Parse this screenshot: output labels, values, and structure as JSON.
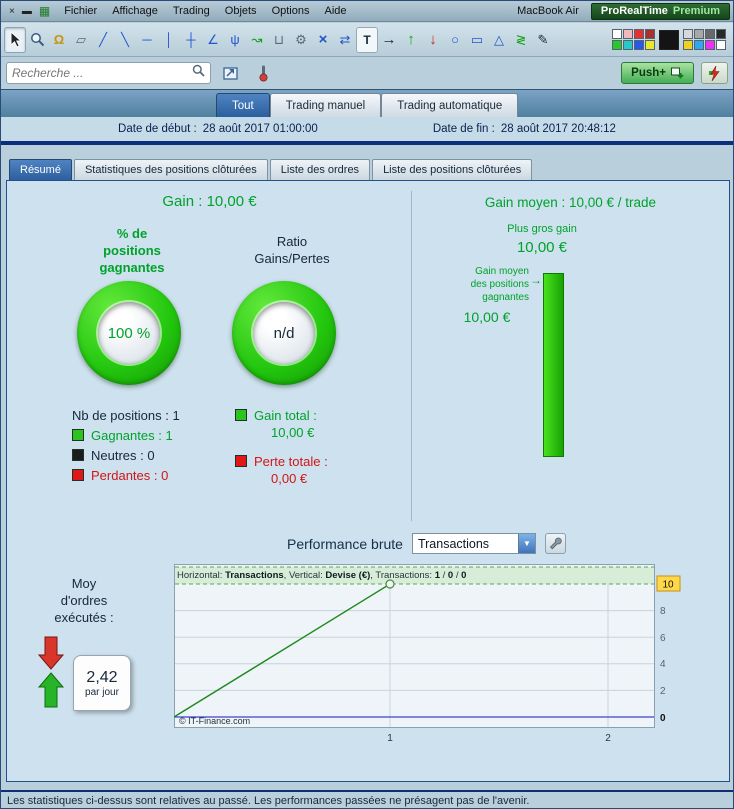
{
  "window_controls": {
    "close_glyph": "×",
    "minimize_glyph": "▬",
    "app_glyph": "▦"
  },
  "titlebar": {
    "menus": [
      "Fichier",
      "Affichage",
      "Trading",
      "Objets",
      "Options",
      "Aide"
    ],
    "machine": "MacBook Air",
    "brand": "ProRealTime",
    "brand_edition": "Premium"
  },
  "toolbar": {
    "icons": [
      {
        "name": "pointer-tool-icon",
        "glyph": ""
      },
      {
        "name": "zoom-icon",
        "glyph": ""
      },
      {
        "name": "alarm-bell-icon",
        "glyph": "Ω"
      },
      {
        "name": "ruler-icon",
        "glyph": "▱"
      },
      {
        "name": "trendline-icon",
        "glyph": "╱"
      },
      {
        "name": "segment-icon",
        "glyph": "╲"
      },
      {
        "name": "horizontal-line-icon",
        "glyph": "─"
      },
      {
        "name": "vertical-line-icon",
        "glyph": "│"
      },
      {
        "name": "cross-line-icon",
        "glyph": "┼"
      },
      {
        "name": "fan-lines-icon",
        "glyph": "∠"
      },
      {
        "name": "pitchfork-icon",
        "glyph": "ψ"
      },
      {
        "name": "price-pattern-icon",
        "glyph": "↝"
      },
      {
        "name": "trash-icon",
        "glyph": "⊔"
      },
      {
        "name": "tools-icon",
        "glyph": "⚙"
      },
      {
        "name": "crossed-arrows-icon",
        "glyph": "×"
      },
      {
        "name": "swap-arrows-icon",
        "glyph": "⇄"
      },
      {
        "name": "text-tool-icon",
        "glyph": "T"
      },
      {
        "name": "arrow-annotation-icon",
        "glyph": "→"
      },
      {
        "name": "buy-arrow-icon",
        "glyph": "↑"
      },
      {
        "name": "sell-arrow-icon",
        "glyph": "↓"
      },
      {
        "name": "ellipse-tool-icon",
        "glyph": "○"
      },
      {
        "name": "rectangle-tool-icon",
        "glyph": "▭"
      },
      {
        "name": "triangle-tool-icon",
        "glyph": "△"
      },
      {
        "name": "zigzag-icon",
        "glyph": "≷"
      },
      {
        "name": "pencil-plus-icon",
        "glyph": "✎"
      }
    ],
    "palette_left": [
      [
        "#ffffff",
        "#f2b8c0",
        "#e83030",
        "#a83030"
      ],
      [
        "#28c828",
        "#28c8c8",
        "#2858e8",
        "#e8e828"
      ]
    ],
    "palette_main": "#141414",
    "palette_right": [
      [
        "#d8d8d8",
        "#a8a8a8",
        "#686868",
        "#282828"
      ],
      [
        "#f0d020",
        "#30a8f0",
        "#f030f0",
        "#ffffff"
      ]
    ]
  },
  "search": {
    "placeholder": "Recherche ...",
    "push_label": "Push+"
  },
  "view_tabs": [
    {
      "label": "Tout"
    },
    {
      "label": "Trading manuel"
    },
    {
      "label": "Trading automatique"
    }
  ],
  "dates": {
    "start_label": "Date de début :",
    "start_value": "28 août 2017 01:00:00",
    "end_label": "Date de fin :",
    "end_value": "28 août 2017 20:48:12"
  },
  "panel_tabs": [
    {
      "label": "Résumé"
    },
    {
      "label": "Statistiques des positions clôturées"
    },
    {
      "label": "Liste des ordres"
    },
    {
      "label": "Liste des positions clôturées"
    }
  ],
  "summary": {
    "gain_label": "Gain :",
    "gain_value": "10,00 €",
    "winning_pct_title": "% de\npositions\ngagnantes",
    "winning_pct_value": "100 %",
    "ratio_title": "Ratio\nGains/Pertes",
    "ratio_value": "n/d",
    "nb_positions": "Nb de positions : 1",
    "winners": "Gagnantes : 1",
    "neutrals": "Neutres : 0",
    "losers": "Perdantes : 0",
    "gain_total_label": "Gain total :",
    "gain_total_value": "10,00 €",
    "loss_total_label": "Perte totale :",
    "loss_total_value": "0,00 €"
  },
  "right_stats": {
    "avg_gain_label": "Gain moyen :",
    "avg_gain_value": "10,00 € / trade",
    "biggest_gain_label": "Plus gros gain",
    "biggest_gain_value": "10,00 €",
    "avg_win_label": "Gain moyen\ndes positions\ngagnantes",
    "avg_win_arrow": "→",
    "avg_win_value": "10,00 €"
  },
  "performance": {
    "title": "Performance brute",
    "dropdown_value": "Transactions",
    "orders_title": "Moy\nd'ordres\nexécutés :",
    "orders_value": "2,42",
    "orders_unit": "par jour"
  },
  "icons": {
    "select_arrow": "▼"
  },
  "chart_header": {
    "h_label": "Horizontal: ",
    "h_value": "Transactions",
    "sep1": ", Vertical: ",
    "v_value": "Devise (€)",
    "sep2": ", Transactions: ",
    "wins": "1",
    "sep3": " / ",
    "neutrals": "0",
    "sep4": " / ",
    "losses": "0"
  },
  "chart_data": {
    "type": "line",
    "title": "Performance brute",
    "xlabel": "Transactions",
    "ylabel": "Devise (€)",
    "x": [
      0,
      1
    ],
    "y": [
      0,
      10
    ],
    "transactions_summary": {
      "winning": 1,
      "neutral": 0,
      "losing": 0
    },
    "xticks": [
      "1",
      "2"
    ],
    "yticks": [
      "0",
      "2",
      "4",
      "6",
      "8",
      "10"
    ],
    "xlim": [
      0,
      2.2
    ],
    "ylim": [
      0,
      10.8
    ],
    "highlight_level": 10,
    "grid": true,
    "line_color": "#1d8a1d",
    "zero_line_color": "#4040d0",
    "highlight_band_color": "#d8edd8",
    "credit": "© IT-Finance.com"
  },
  "statusbar": {
    "text": "Les statistiques ci-dessus sont relatives au passé. Les performances passées ne présagent pas de l'avenir."
  },
  "colors": {
    "positive": "#00a22b",
    "negative": "#d21616",
    "accent_blue": "#2c5f9e",
    "win_swatch": "#2ec41f",
    "neutral_swatch": "#1c1c1c",
    "loss_swatch": "#e01818"
  }
}
